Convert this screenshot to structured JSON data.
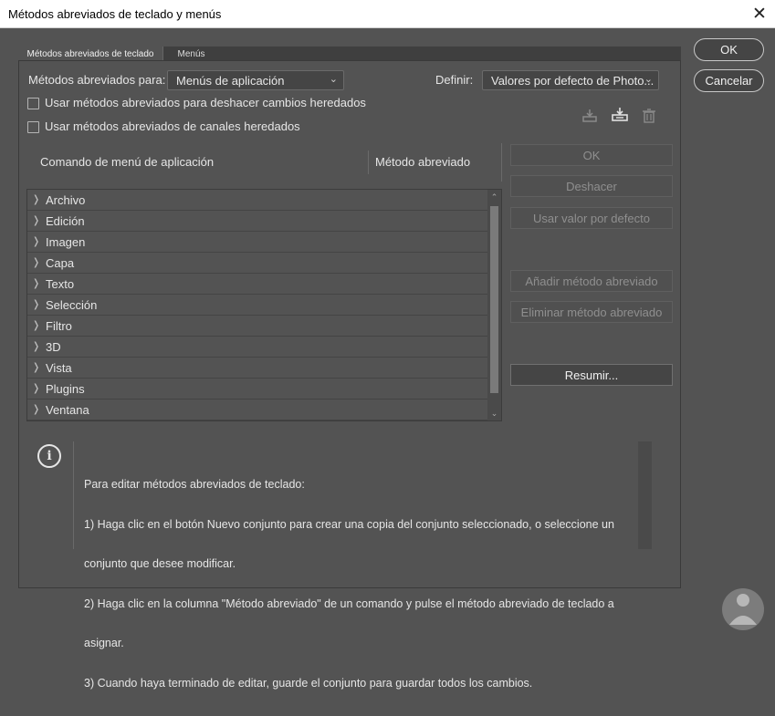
{
  "window": {
    "title": "Métodos abreviados de teclado y menús",
    "close_glyph": "✕"
  },
  "tabs": [
    {
      "label": "Métodos abreviados de teclado"
    },
    {
      "label": "Menús"
    }
  ],
  "shortcuts_for": {
    "label": "Métodos abreviados para:",
    "value": "Menús de aplicación"
  },
  "set": {
    "label": "Definir:",
    "value": "Valores por defecto de Photo..."
  },
  "checkboxes": [
    {
      "label": "Usar métodos abreviados para deshacer cambios heredados",
      "checked": false
    },
    {
      "label": "Usar métodos abreviados de canales heredados",
      "checked": false
    }
  ],
  "columns": {
    "command": "Comando de menú de aplicación",
    "shortcut": "Método abreviado"
  },
  "menu_items": [
    {
      "label": "Archivo"
    },
    {
      "label": "Edición"
    },
    {
      "label": "Imagen"
    },
    {
      "label": "Capa"
    },
    {
      "label": "Texto"
    },
    {
      "label": "Selección"
    },
    {
      "label": "Filtro"
    },
    {
      "label": "3D"
    },
    {
      "label": "Vista"
    },
    {
      "label": "Plugins"
    },
    {
      "label": "Ventana"
    }
  ],
  "side_buttons": {
    "ok": "OK",
    "undo": "Deshacer",
    "use_default": "Usar valor por defecto",
    "add_shortcut": "Añadir método abreviado",
    "delete_shortcut": "Eliminar método abreviado",
    "summarize": "Resumir..."
  },
  "toolbar_icons": [
    "save-set-icon",
    "new-set-icon",
    "delete-set-icon"
  ],
  "info": {
    "icon": "info-icon",
    "lines": [
      "Para editar métodos abreviados de teclado:",
      "1) Haga clic en el botón Nuevo conjunto para crear una copia del conjunto seleccionado, o seleccione un",
      "conjunto que desee modificar.",
      "2) Haga clic en la columna \"Método abreviado\" de un comando y pulse el método abreviado de teclado a",
      "asignar.",
      "3) Cuando haya terminado de editar, guarde el conjunto para guardar todos los cambios."
    ]
  },
  "dialog_buttons": {
    "ok": "OK",
    "cancel": "Cancelar"
  },
  "colors": {
    "dialog_bg": "#535353",
    "titlebar_bg": "#ffffff",
    "disabled_text": "#8f8f8f"
  }
}
